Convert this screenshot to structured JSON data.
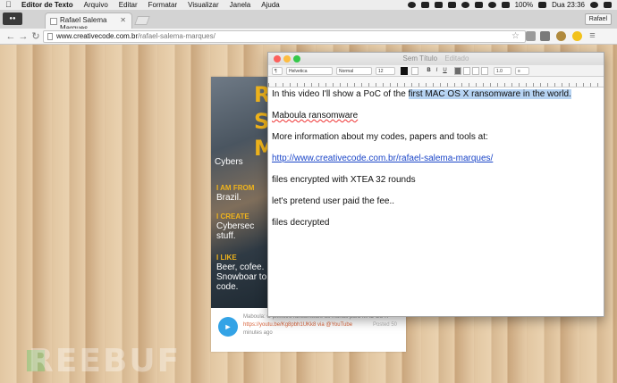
{
  "menubar": {
    "app": "Editor de Texto",
    "items": [
      "Arquivo",
      "Editar",
      "Formatar",
      "Visualizar",
      "Janela",
      "Ajuda"
    ],
    "battery": "100%",
    "clock": "Dua 23:36"
  },
  "browser": {
    "tab_title": "Rafael Salema Marques",
    "profile": "Rafael",
    "url_host": "www.creativecode.com.br",
    "url_path": "/rafael-salema-marques/"
  },
  "card": {
    "big_letters": [
      "R",
      "S",
      "M"
    ],
    "cyber_label": "Cybers",
    "sections": [
      {
        "label": "I AM FROM",
        "text": "Brazil."
      },
      {
        "label": "I CREATE",
        "text": "Cybersec stuff."
      },
      {
        "label": "I LIKE",
        "text": "Beer, cofee. Snowboar to code."
      }
    ],
    "tweet_text": "Maboula: O primeiro ransomware do mundo para MAC OS X",
    "tweet_link": "https://youtu.be/Kg8pbh1UKk8 via @YouTube",
    "tweet_posted": "Posted 50",
    "tweet_time": "minutes ago"
  },
  "textedit": {
    "title": "Sem Título",
    "status": "Editado",
    "font_family": "Helvetica",
    "font_style": "Normal",
    "font_size": "12",
    "line_spacing": "1.0",
    "lines": [
      {
        "pre": "In this video I'll show a PoC of the ",
        "hl": "first MAC OS X ransomware in the world."
      },
      {
        "pre": "Maboula ransomware"
      },
      {
        "pre": "More information about my codes, papers and tools at:"
      },
      {
        "link": "http://www.creativecode.com.br/rafael-salema-marques/"
      },
      {
        "pre": "files encrypted with XTEA 32 rounds"
      },
      {
        "pre": "let's pretend user paid the fee.."
      },
      {
        "pre": "files decrypted"
      }
    ]
  },
  "watermark": "REEBUF"
}
